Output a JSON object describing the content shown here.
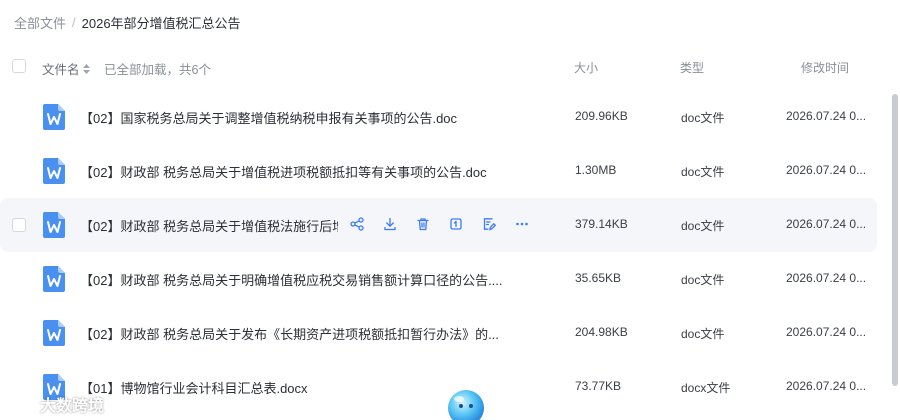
{
  "breadcrumb": {
    "root": "全部文件",
    "separator": "/",
    "current": "2026年部分增值税汇总公告"
  },
  "table": {
    "header": {
      "name": "文件名",
      "loaded_status": "已全部加载，共6个",
      "size": "大小",
      "type": "类型",
      "modified": "修改时间"
    },
    "rows": [
      {
        "name": "【02】国家税务总局关于调整增值税纳税申报有关事项的公告.doc",
        "size": "209.96KB",
        "type": "doc文件",
        "modified": "2026.07.24 0..."
      },
      {
        "name": "【02】财政部 税务总局关于增值税进项税额抵扣等有关事项的公告.doc",
        "size": "1.30MB",
        "type": "doc文件",
        "modified": "2026.07.24 0..."
      },
      {
        "name": "【02】财政部 税务总局关于增值税法施行后增",
        "size": "379.14KB",
        "type": "doc文件",
        "modified": "2026.07.24 0..."
      },
      {
        "name": "【02】财政部 税务总局关于明确增值税应税交易销售额计算口径的公告....",
        "size": "35.65KB",
        "type": "doc文件",
        "modified": "2026.07.24 0..."
      },
      {
        "name": "【02】财政部 税务总局关于发布《长期资产进项税额抵扣暂行办法》的...",
        "size": "204.98KB",
        "type": "doc文件",
        "modified": "2026.07.24 0..."
      },
      {
        "name": "【01】博物馆行业会计科目汇总表.docx",
        "size": "73.77KB",
        "type": "docx文件",
        "modified": "2026.07.24 0..."
      }
    ]
  },
  "row_actions": [
    "share-icon",
    "download-icon",
    "delete-icon",
    "copy-icon",
    "edit-icon",
    "more-icon"
  ],
  "watermark": {
    "text": "大数跨境"
  },
  "colors": {
    "accent": "#3b7bf6",
    "word_icon": "#4a90f0",
    "hover_row": "#f4f6fa"
  }
}
